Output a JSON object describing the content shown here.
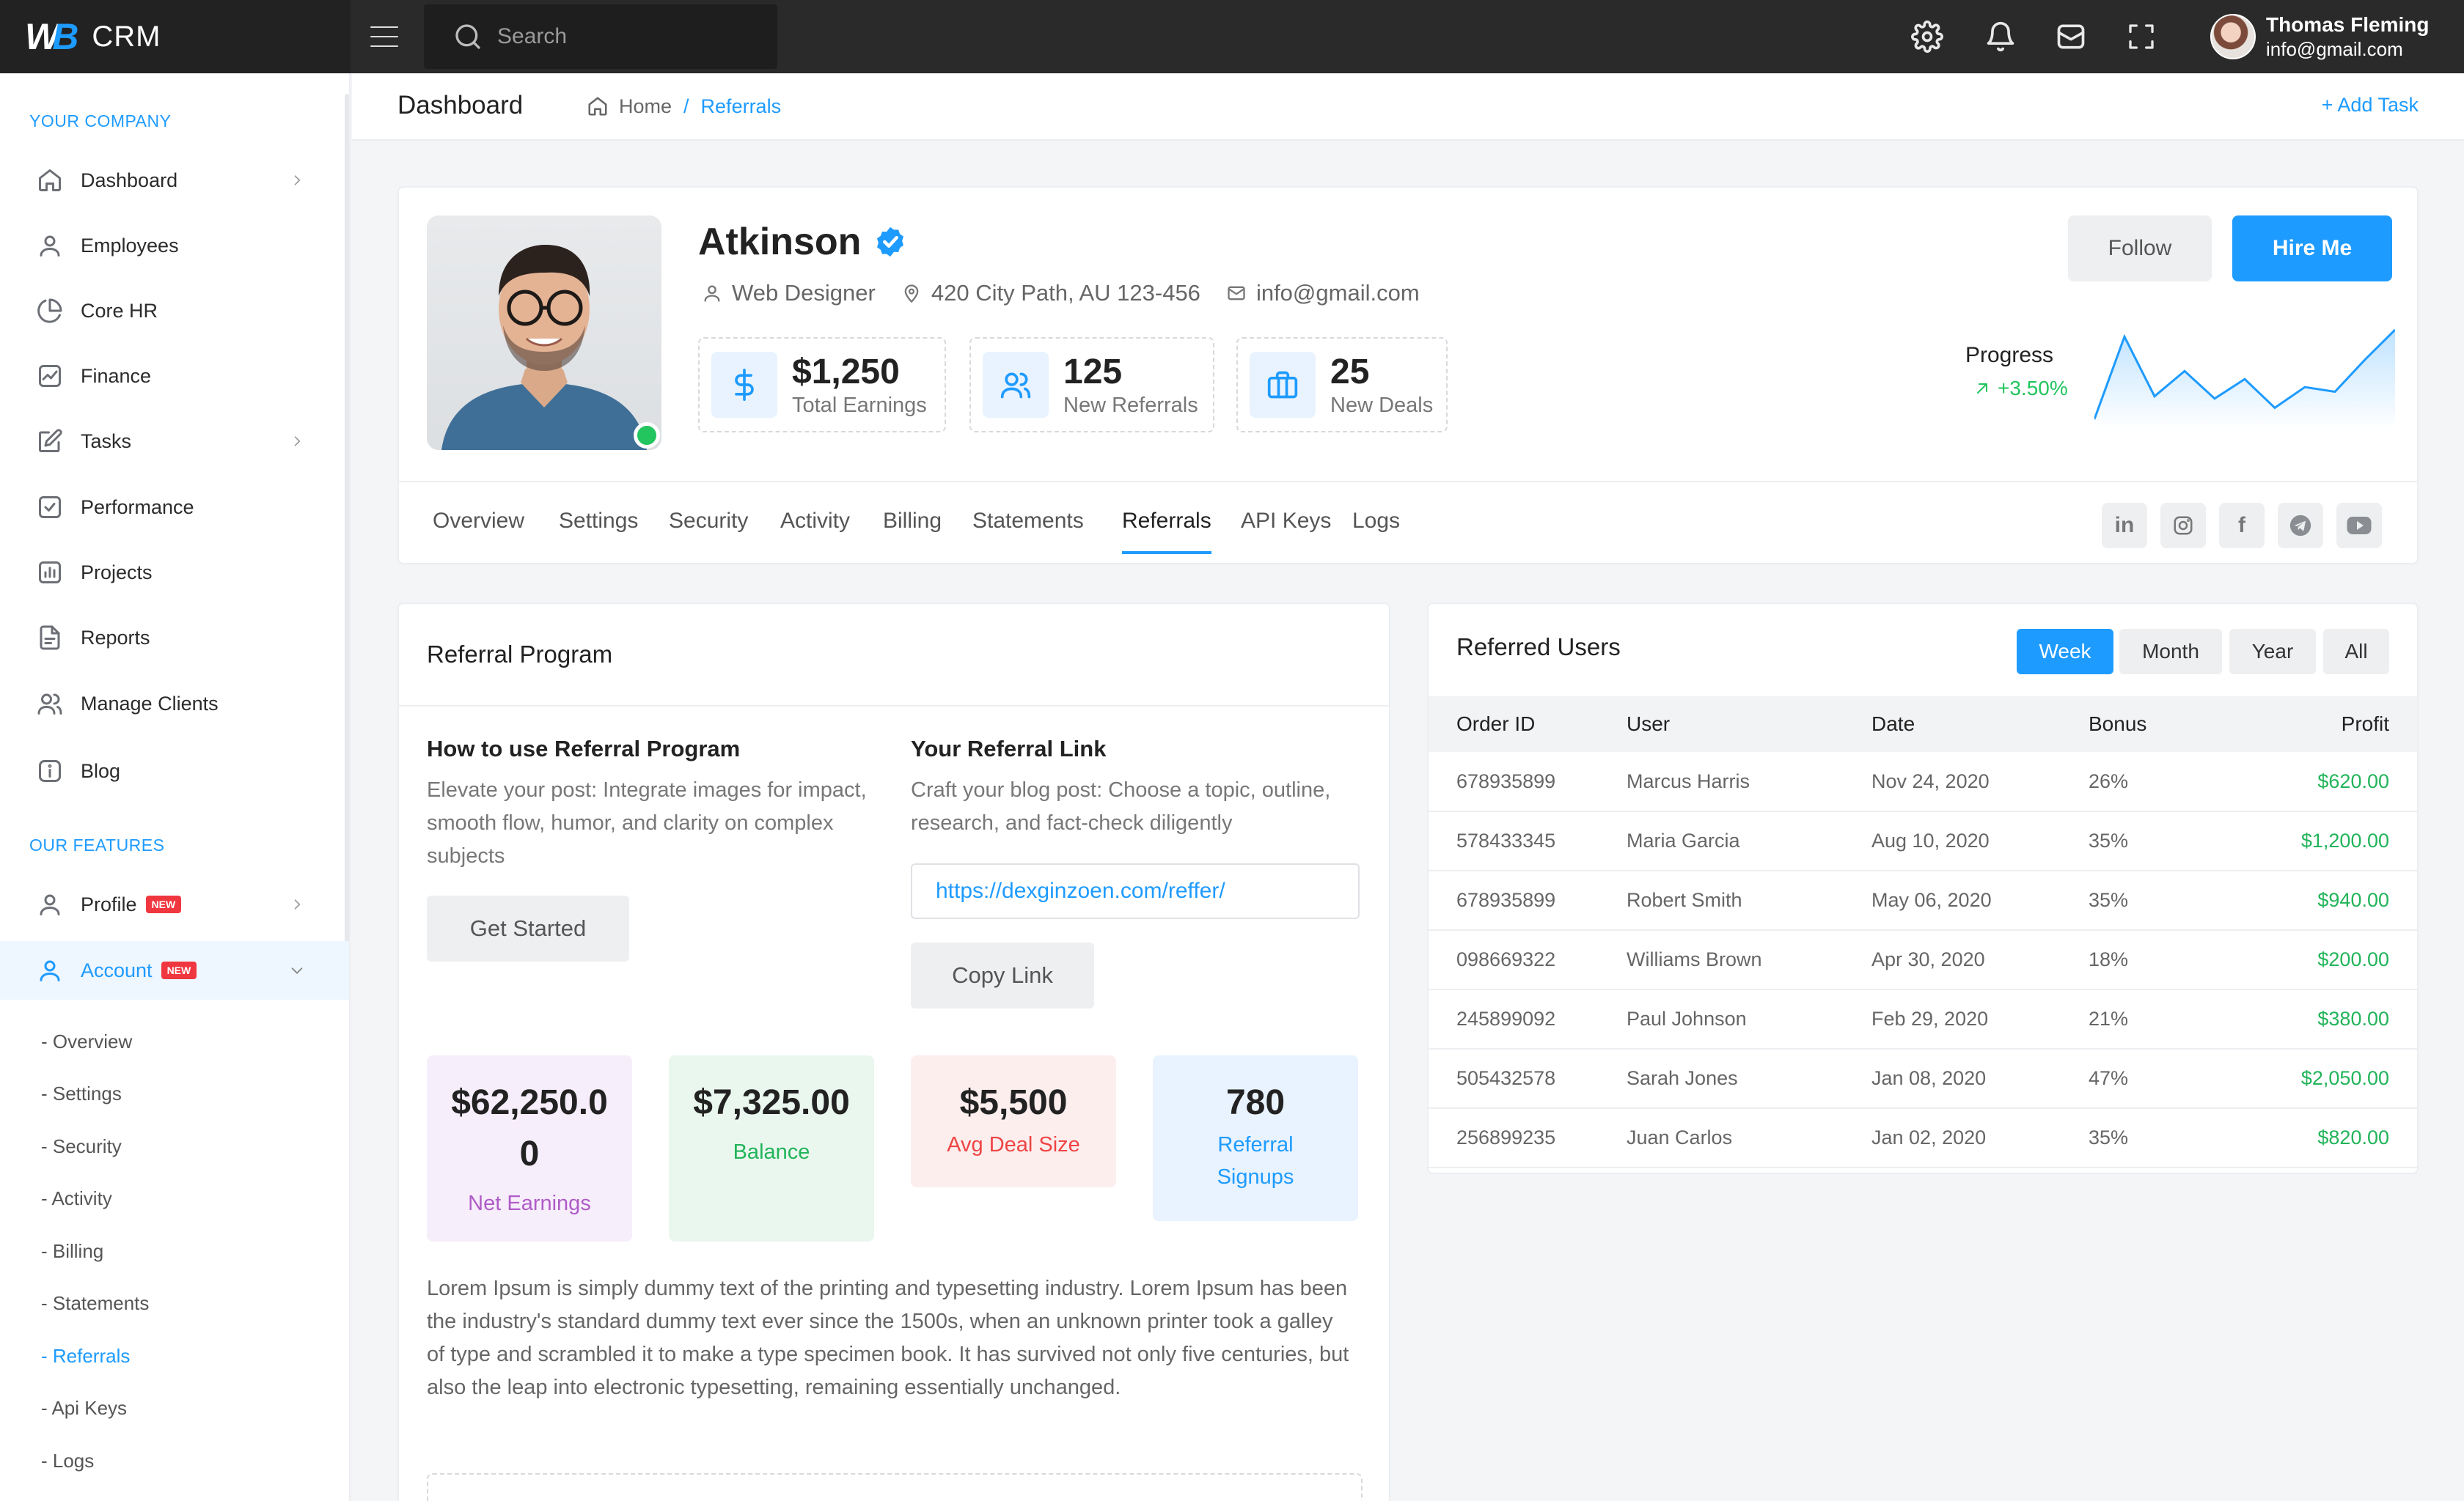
{
  "brand": {
    "logo": "WB",
    "name": "CRM"
  },
  "search": {
    "placeholder": "Search"
  },
  "user": {
    "name": "Thomas Fleming",
    "email": "info@gmail.com"
  },
  "sidebar": {
    "section1": "YOUR COMPANY",
    "items": [
      {
        "label": "Dashboard",
        "icon": "home-icon"
      },
      {
        "label": "Employees",
        "icon": "user-icon"
      },
      {
        "label": "Core HR",
        "icon": "pie-chart-icon"
      },
      {
        "label": "Finance",
        "icon": "chart-line-icon"
      },
      {
        "label": "Tasks",
        "icon": "edit-icon"
      },
      {
        "label": "Performance",
        "icon": "check-square-icon"
      },
      {
        "label": "Projects",
        "icon": "bar-chart-icon"
      },
      {
        "label": "Reports",
        "icon": "file-icon"
      },
      {
        "label": "Manage Clients",
        "icon": "users-icon"
      },
      {
        "label": "Blog",
        "icon": "info-icon"
      }
    ],
    "section2": "OUR FEATURES",
    "profile": {
      "label": "Profile",
      "badge": "NEW"
    },
    "account": {
      "label": "Account",
      "badge": "NEW"
    },
    "sub": [
      "- Overview",
      "- Settings",
      "- Security",
      "- Activity",
      "- Billing",
      "- Statements",
      "- Referrals",
      "- Api Keys",
      "- Logs"
    ]
  },
  "header": {
    "title": "Dashboard",
    "home": "Home",
    "sep": "/",
    "current": "Referrals",
    "add_task": "+ Add Task"
  },
  "profile": {
    "name": "Atkinson",
    "role": "Web Designer",
    "address": "420 City Path, AU 123-456",
    "email": "info@gmail.com",
    "stats": [
      {
        "value": "$1,250",
        "label": "Total Earnings",
        "icon": "dollar-icon"
      },
      {
        "value": "125",
        "label": "New Referrals",
        "icon": "users-icon"
      },
      {
        "value": "25",
        "label": "New Deals",
        "icon": "briefcase-icon"
      }
    ],
    "follow": "Follow",
    "hire": "Hire Me",
    "progress_label": "Progress",
    "progress_value": "+3.50%",
    "sparkline": [
      20,
      92,
      40,
      62,
      38,
      55,
      30,
      48,
      44,
      72,
      98
    ]
  },
  "tabs": [
    "Overview",
    "Settings",
    "Security",
    "Activity",
    "Billing",
    "Statements",
    "Referrals",
    "API Keys",
    "Logs"
  ],
  "active_tab": "Referrals",
  "social": [
    "in",
    "instagram-icon",
    "f",
    "telegram-icon",
    "youtube-icon"
  ],
  "referral": {
    "title": "Referral Program",
    "how_title": "How to use Referral Program",
    "how_text": "Elevate your post: Integrate images for impact, smooth flow, humor, and clarity on complex subjects",
    "get_started": "Get Started",
    "link_title": "Your Referral Link",
    "link_text": "Craft your blog post: Choose a topic, outline, research, and fact-check diligently",
    "link_value": "https://dexginzoen.com/reffer/",
    "copy": "Copy Link",
    "kpis": [
      {
        "value": "$62,250.00",
        "label": "Net Earnings",
        "bg": "#f7eefb",
        "color": "#b05cc8"
      },
      {
        "value": "$7,325.00",
        "label": "Balance",
        "bg": "#eaf7ef",
        "color": "#22b45a"
      },
      {
        "value": "$5,500",
        "label": "Avg Deal Size",
        "bg": "#fdeeee",
        "color": "#ef4444"
      },
      {
        "value": "780",
        "label": "Referral Signups",
        "bg": "#e8f3ff",
        "color": "#1e9bff"
      }
    ],
    "lorem": "Lorem Ipsum is simply dummy text of the printing and typesetting industry. Lorem Ipsum has been the industry's standard dummy text ever since the 1500s, when an unknown printer took a galley of type and scrambled it to make a type specimen book. It has survived not only five centuries, but also the leap into electronic typesetting, remaining essentially unchanged."
  },
  "users": {
    "title": "Referred Users",
    "ranges": [
      "Week",
      "Month",
      "Year",
      "All"
    ],
    "active_range": "Week",
    "columns": [
      "Order ID",
      "User",
      "Date",
      "Bonus",
      "Profit"
    ],
    "rows": [
      [
        "678935899",
        "Marcus Harris",
        "Nov 24, 2020",
        "26%",
        "$620.00"
      ],
      [
        "578433345",
        "Maria Garcia",
        "Aug 10, 2020",
        "35%",
        "$1,200.00"
      ],
      [
        "678935899",
        "Robert Smith",
        "May 06, 2020",
        "35%",
        "$940.00"
      ],
      [
        "098669322",
        "Williams Brown",
        "Apr 30, 2020",
        "18%",
        "$200.00"
      ],
      [
        "245899092",
        "Paul Johnson",
        "Feb 29, 2020",
        "21%",
        "$380.00"
      ],
      [
        "505432578",
        "Sarah Jones",
        "Jan 08, 2020",
        "47%",
        "$2,050.00"
      ],
      [
        "256899235",
        "Juan Carlos",
        "Jan 02, 2020",
        "35%",
        "$820.00"
      ]
    ]
  },
  "colors": {
    "accent": "#1e9bff",
    "success": "#22c55e",
    "topbar": "#2a2a2a"
  }
}
